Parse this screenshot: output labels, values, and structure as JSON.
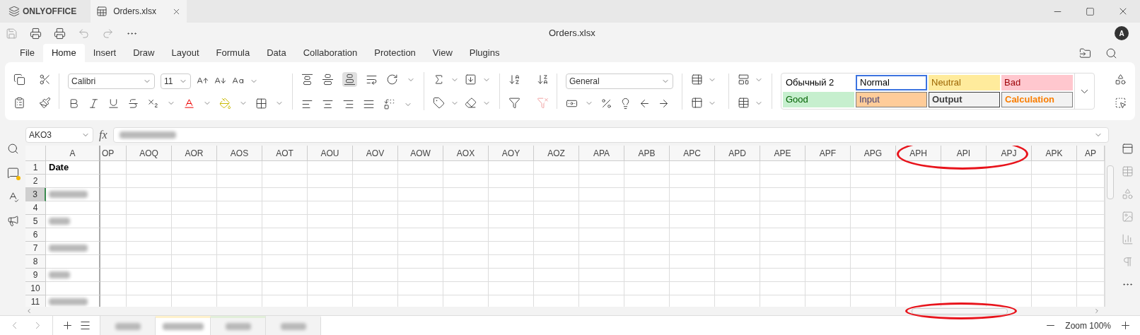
{
  "app_tabs": {
    "brand": "ONLYOFFICE",
    "document": "Orders.xlsx"
  },
  "title": "Orders.xlsx",
  "avatar": "A",
  "menu_tabs": [
    {
      "label": "File",
      "selected": false
    },
    {
      "label": "Home",
      "selected": true
    },
    {
      "label": "Insert",
      "selected": false
    },
    {
      "label": "Draw",
      "selected": false
    },
    {
      "label": "Layout",
      "selected": false
    },
    {
      "label": "Formula",
      "selected": false
    },
    {
      "label": "Data",
      "selected": false
    },
    {
      "label": "Collaboration",
      "selected": false
    },
    {
      "label": "Protection",
      "selected": false
    },
    {
      "label": "View",
      "selected": false
    },
    {
      "label": "Plugins",
      "selected": false
    }
  ],
  "ribbon": {
    "font_name": "Calibri",
    "font_size": "11",
    "number_format": "General",
    "styles": [
      {
        "label": "Обычный 2",
        "kind": "plain",
        "selected": false
      },
      {
        "label": "Normal",
        "kind": "plain",
        "selected": true
      },
      {
        "label": "Neutral",
        "kind": "neutral",
        "selected": false
      },
      {
        "label": "Bad",
        "kind": "bad",
        "selected": false
      },
      {
        "label": "Good",
        "kind": "good",
        "selected": false
      },
      {
        "label": "Input",
        "kind": "input",
        "selected": false
      },
      {
        "label": "Output",
        "kind": "output",
        "selected": false
      },
      {
        "label": "Calculation",
        "kind": "calculation",
        "selected": false
      }
    ]
  },
  "name_box": "AKO3",
  "formula_label": "fx",
  "formula": {
    "redacted": true
  },
  "sheet": {
    "columns": [
      "A",
      "OP",
      "AOQ",
      "AOR",
      "AOS",
      "AOT",
      "AOU",
      "AOV",
      "AOW",
      "AOX",
      "AOY",
      "AOZ",
      "APA",
      "APB",
      "APC",
      "APD",
      "APE",
      "APF",
      "APG",
      "APH",
      "API",
      "APJ",
      "APK",
      "AP"
    ],
    "rows": [
      {
        "number": "1",
        "selected": false,
        "cell": "Date"
      },
      {
        "number": "2",
        "selected": false
      },
      {
        "number": "3",
        "selected": true,
        "redacted": true
      },
      {
        "number": "4",
        "selected": false
      },
      {
        "number": "5",
        "selected": false,
        "redacted": true
      },
      {
        "number": "6",
        "selected": false
      },
      {
        "number": "7",
        "selected": false,
        "redacted": true
      },
      {
        "number": "8",
        "selected": false
      },
      {
        "number": "9",
        "selected": false,
        "redacted": true
      },
      {
        "number": "10",
        "selected": false
      },
      {
        "number": "11",
        "selected": false,
        "redacted": true
      }
    ]
  },
  "sheet_tabs": [
    {
      "selected": false
    },
    {
      "selected": true,
      "color": "#fff2cc"
    },
    {
      "selected": false,
      "color": "#e2efda"
    },
    {
      "selected": false
    }
  ],
  "zoom": "Zoom 100%"
}
